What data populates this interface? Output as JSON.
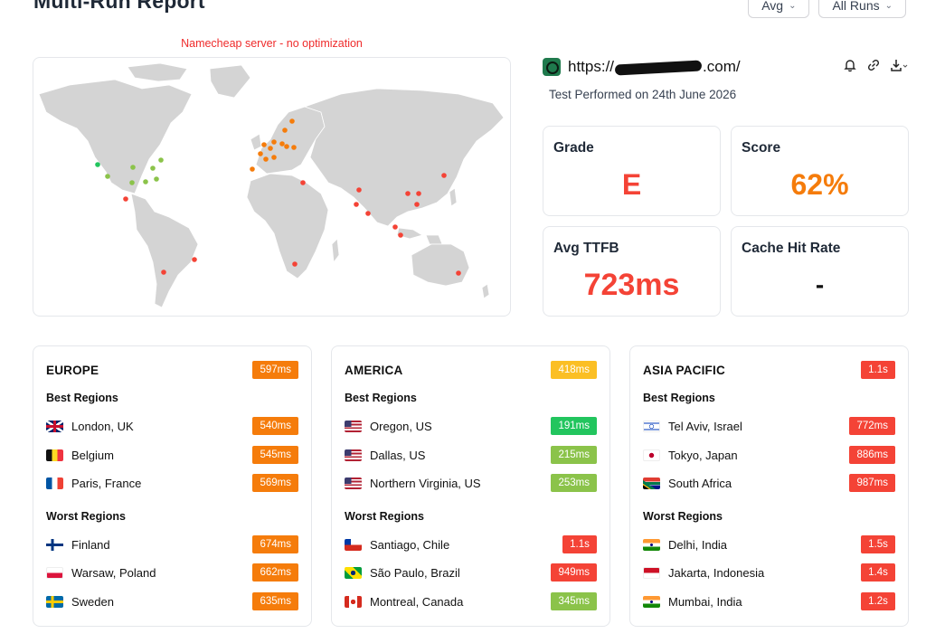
{
  "header": {
    "title": "Multi-Run Report",
    "avg_dropdown": "Avg",
    "runs_dropdown": "All Runs"
  },
  "map": {
    "caption": "Namecheap server - no optimization"
  },
  "site": {
    "url_prefix": "https://",
    "url_suffix": ".com/",
    "test_date": "Test Performed on 24th June 2026"
  },
  "stats": {
    "grade_label": "Grade",
    "grade_value": "E",
    "score_label": "Score",
    "score_value": "62%",
    "ttfb_label": "Avg TTFB",
    "ttfb_value": "723ms",
    "cache_label": "Cache Hit Rate",
    "cache_value": "-"
  },
  "colors": {
    "red": "#f44336",
    "orange": "#f57c0b",
    "yellow": "#fbbf24",
    "green": "#22c55e",
    "lightgreen": "#8bc34a"
  },
  "regions": [
    {
      "name": "EUROPE",
      "avg": "597ms",
      "avg_color": "#f57c0b",
      "best_label": "Best Regions",
      "worst_label": "Worst Regions",
      "best": [
        {
          "flag": "uk",
          "name": "London, UK",
          "value": "540ms",
          "color": "#f57c0b"
        },
        {
          "flag": "belgium",
          "name": "Belgium",
          "value": "545ms",
          "color": "#f57c0b"
        },
        {
          "flag": "france",
          "name": "Paris, France",
          "value": "569ms",
          "color": "#f57c0b"
        }
      ],
      "worst": [
        {
          "flag": "finland",
          "name": "Finland",
          "value": "674ms",
          "color": "#f57c0b"
        },
        {
          "flag": "poland",
          "name": "Warsaw, Poland",
          "value": "662ms",
          "color": "#f57c0b"
        },
        {
          "flag": "sweden",
          "name": "Sweden",
          "value": "635ms",
          "color": "#f57c0b"
        }
      ]
    },
    {
      "name": "AMERICA",
      "avg": "418ms",
      "avg_color": "#fbbf24",
      "best_label": "Best Regions",
      "worst_label": "Worst Regions",
      "best": [
        {
          "flag": "us",
          "name": "Oregon, US",
          "value": "191ms",
          "color": "#22c55e"
        },
        {
          "flag": "us",
          "name": "Dallas, US",
          "value": "215ms",
          "color": "#8bc34a"
        },
        {
          "flag": "us",
          "name": "Northern Virginia, US",
          "value": "253ms",
          "color": "#8bc34a"
        }
      ],
      "worst": [
        {
          "flag": "chile",
          "name": "Santiago, Chile",
          "value": "1.1s",
          "color": "#f44336"
        },
        {
          "flag": "brazil",
          "name": "São Paulo, Brazil",
          "value": "949ms",
          "color": "#f44336"
        },
        {
          "flag": "canada",
          "name": "Montreal, Canada",
          "value": "345ms",
          "color": "#8bc34a"
        }
      ]
    },
    {
      "name": "ASIA PACIFIC",
      "avg": "1.1s",
      "avg_color": "#f44336",
      "best_label": "Best Regions",
      "worst_label": "Worst Regions",
      "best": [
        {
          "flag": "israel",
          "name": "Tel Aviv, Israel",
          "value": "772ms",
          "color": "#f44336"
        },
        {
          "flag": "japan",
          "name": "Tokyo, Japan",
          "value": "886ms",
          "color": "#f44336"
        },
        {
          "flag": "southafrica",
          "name": "South Africa",
          "value": "987ms",
          "color": "#f44336"
        }
      ],
      "worst": [
        {
          "flag": "india",
          "name": "Delhi, India",
          "value": "1.5s",
          "color": "#f44336"
        },
        {
          "flag": "indonesia",
          "name": "Jakarta, Indonesia",
          "value": "1.4s",
          "color": "#f44336"
        },
        {
          "flag": "india",
          "name": "Mumbai, India",
          "value": "1.2s",
          "color": "#f44336"
        }
      ]
    }
  ]
}
